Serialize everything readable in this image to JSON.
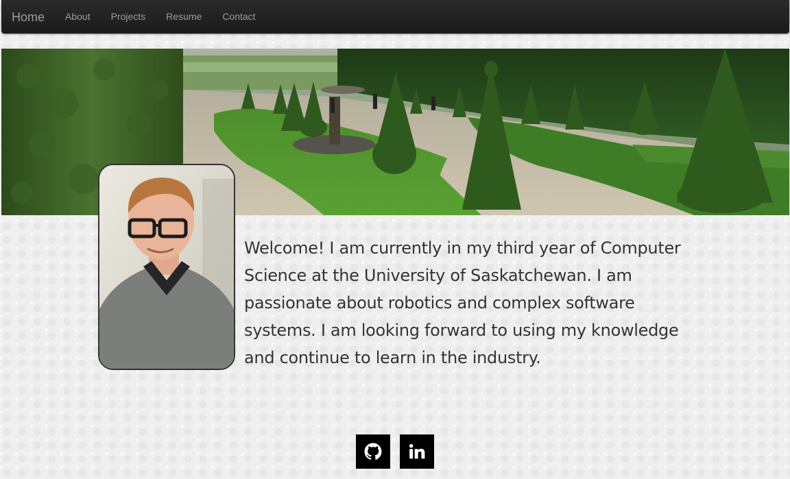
{
  "navbar": {
    "brand": "Home",
    "links": [
      {
        "label": "About"
      },
      {
        "label": "Projects"
      },
      {
        "label": "Resume"
      },
      {
        "label": "Contact"
      }
    ]
  },
  "banner": {
    "alt_description": "garden-banner-photo"
  },
  "profile": {
    "alt_description": "profile-photo"
  },
  "intro": {
    "text": "Welcome! I am currently in my third year of Computer Science at the University of Saskatchewan. I am passionate about robotics and complex software systems. I am looking forward to using my knowledge and continue to learn in the industry."
  },
  "social": [
    {
      "icon": "github-icon"
    },
    {
      "icon": "linkedin-icon"
    }
  ],
  "colors": {
    "navbar_bg": "#222222",
    "nav_text": "#9d9d9d",
    "social_bg": "#000000",
    "body_text": "#333333"
  }
}
